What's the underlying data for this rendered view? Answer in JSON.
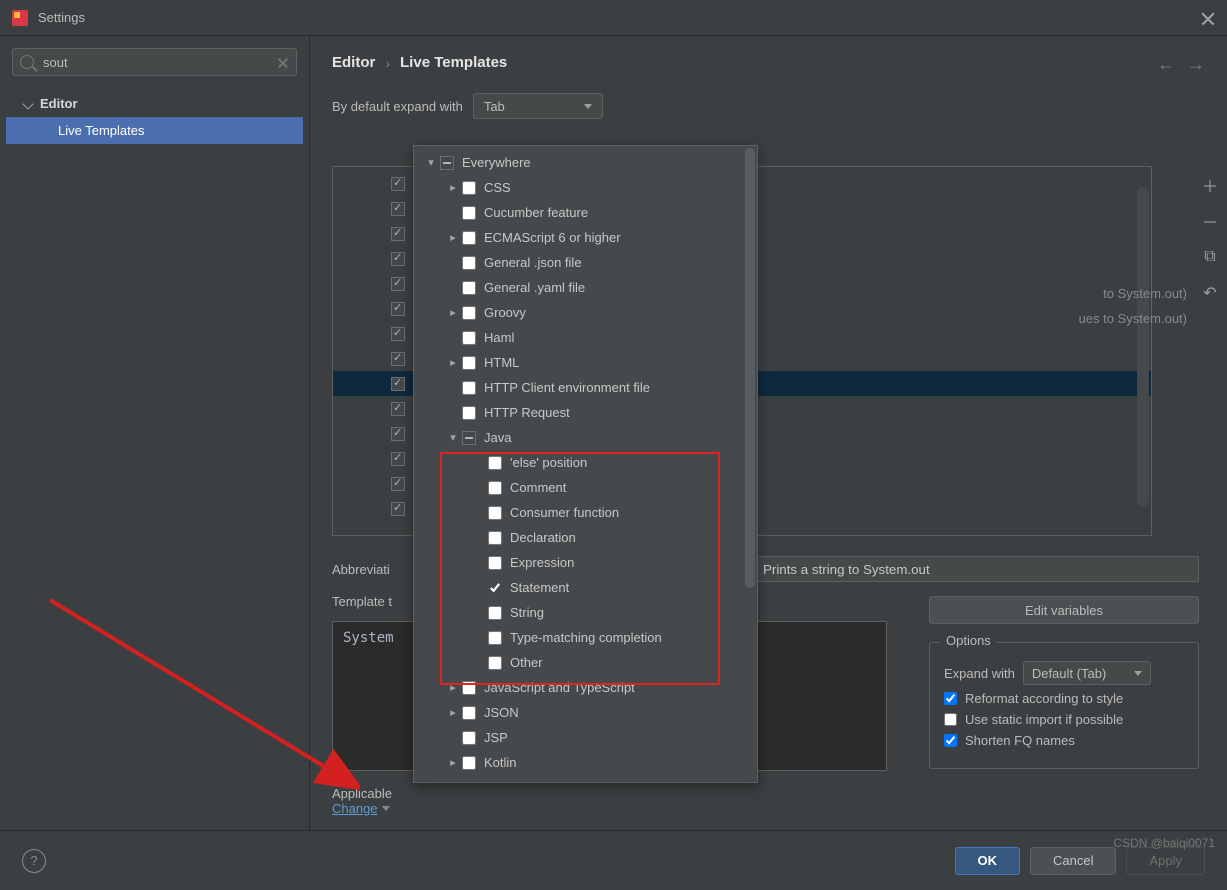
{
  "window": {
    "title": "Settings"
  },
  "sidebar": {
    "search_value": "sout",
    "editor_label": "Editor",
    "live_templates_label": "Live Templates"
  },
  "breadcrumb": {
    "editor": "Editor",
    "sep": "›",
    "live_templates": "Live Templates"
  },
  "expand": {
    "label": "By default expand with",
    "value": "Tab"
  },
  "info": {
    "line1": "to System.out)",
    "line2": "ues to System.out)"
  },
  "form": {
    "abbrev_label": "Abbreviati",
    "desc_value": "Prints a string to System.out",
    "template_label": "Template t",
    "template_text": "System",
    "edit_vars": "Edit variables",
    "options_legend": "Options",
    "expand_with": "Expand with",
    "expand_with_val": "Default (Tab)",
    "reformat": "Reformat according to style",
    "static_import": "Use static import if possible",
    "shorten_fq": "Shorten FQ names",
    "applicable": "Applicable",
    "change": "Change"
  },
  "popup": {
    "root": "Everywhere",
    "top_items": [
      {
        "label": "CSS",
        "arrow": ">"
      },
      {
        "label": "Cucumber feature",
        "arrow": ""
      },
      {
        "label": "ECMAScript 6 or higher",
        "arrow": ">"
      },
      {
        "label": "General .json file",
        "arrow": ""
      },
      {
        "label": "General .yaml file",
        "arrow": ""
      },
      {
        "label": "Groovy",
        "arrow": ">"
      },
      {
        "label": "Haml",
        "arrow": ""
      },
      {
        "label": "HTML",
        "arrow": ">"
      },
      {
        "label": "HTTP Client environment file",
        "arrow": ""
      },
      {
        "label": "HTTP Request",
        "arrow": ""
      }
    ],
    "java_label": "Java",
    "java_children": [
      {
        "label": "'else' position",
        "checked": false
      },
      {
        "label": "Comment",
        "checked": false
      },
      {
        "label": "Consumer function",
        "checked": false
      },
      {
        "label": "Declaration",
        "checked": false
      },
      {
        "label": "Expression",
        "checked": false
      },
      {
        "label": "Statement",
        "checked": true
      },
      {
        "label": "String",
        "checked": false
      },
      {
        "label": "Type-matching completion",
        "checked": false
      },
      {
        "label": "Other",
        "checked": false
      }
    ],
    "bottom_items": [
      {
        "label": "JavaScript and TypeScript",
        "arrow": ">"
      },
      {
        "label": "JSON",
        "arrow": ">"
      },
      {
        "label": "JSP",
        "arrow": ""
      },
      {
        "label": "Kotlin",
        "arrow": ">"
      }
    ]
  },
  "buttons": {
    "ok": "OK",
    "cancel": "Cancel",
    "apply": "Apply"
  },
  "watermark": "CSDN @baiqi0071"
}
